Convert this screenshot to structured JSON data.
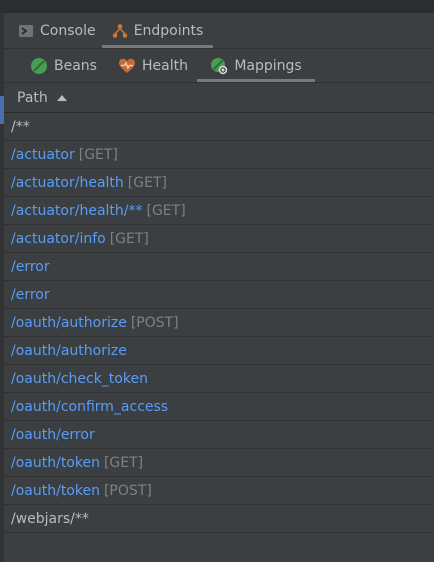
{
  "tabs": {
    "console": "Console",
    "endpoints": "Endpoints"
  },
  "subtabs": {
    "beans": "Beans",
    "health": "Health",
    "mappings": "Mappings"
  },
  "table": {
    "header": "Path",
    "sort": "ascending",
    "rows": [
      {
        "path": "/**",
        "method": "",
        "link": false
      },
      {
        "path": "/actuator",
        "method": "[GET]",
        "link": true
      },
      {
        "path": "/actuator/health",
        "method": "[GET]",
        "link": true
      },
      {
        "path": "/actuator/health/**",
        "method": "[GET]",
        "link": true
      },
      {
        "path": "/actuator/info",
        "method": "[GET]",
        "link": true
      },
      {
        "path": "/error",
        "method": "",
        "link": true
      },
      {
        "path": "/error",
        "method": "",
        "link": true
      },
      {
        "path": "/oauth/authorize",
        "method": "[POST]",
        "link": true
      },
      {
        "path": "/oauth/authorize",
        "method": "",
        "link": true
      },
      {
        "path": "/oauth/check_token",
        "method": "",
        "link": true
      },
      {
        "path": "/oauth/confirm_access",
        "method": "",
        "link": true
      },
      {
        "path": "/oauth/error",
        "method": "",
        "link": true
      },
      {
        "path": "/oauth/token",
        "method": "[GET]",
        "link": true
      },
      {
        "path": "/oauth/token",
        "method": "[POST]",
        "link": true
      },
      {
        "path": "/webjars/**",
        "method": "",
        "link": false
      }
    ]
  },
  "colors": {
    "background": "#3c3f41",
    "link": "#589df6",
    "text": "#bbbbbb",
    "method": "#808080",
    "beans_icon": "#499c54",
    "health_icon": "#c66a3a",
    "endpoints_icon": "#cc7832"
  }
}
